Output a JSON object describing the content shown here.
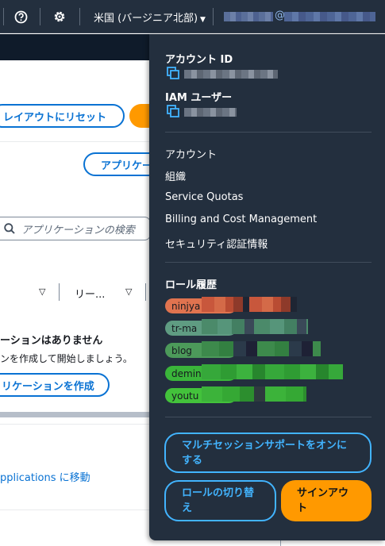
{
  "nav": {
    "help_icon": "question-circle-icon",
    "settings_icon": "gear-icon",
    "region": "米国 (バージニア北部)",
    "account_at": "@"
  },
  "background": {
    "reset_layout_button": "レイアウトにリセット",
    "application_button": "アプリケー",
    "search_placeholder": "アプリケーションの検索",
    "col_header": "リー...",
    "empty_title": "ーションはありません",
    "empty_desc": "ンを作成して開始しましょう。",
    "create_button": "リケーションを作成",
    "move_link": "pplications に移動"
  },
  "dropdown": {
    "account_id_label": "アカウント ID",
    "iam_user_label": "IAM ユーザー",
    "menu": [
      "アカウント",
      "組織",
      "Service Quotas",
      "Billing and Cost Management",
      "セキュリティ認証情報"
    ],
    "role_history_title": "ロール履歴",
    "roles": [
      {
        "name": "ninjya",
        "color": "#e0734f"
      },
      {
        "name": "tr-ma",
        "color": "#5f9c82"
      },
      {
        "name": "blog",
        "color": "#4c9a5a"
      },
      {
        "name": "demin",
        "color": "#3ab53a"
      },
      {
        "name": "youtu",
        "color": "#43c23b"
      }
    ],
    "multisession_button": "マルチセッションサポートをオンにする",
    "switch_role_button": "ロールの切り替え",
    "sign_out_button": "サインアウト"
  },
  "colors": {
    "nav_bg": "#232f3e",
    "link_blue": "#0972d3",
    "accent_orange": "#ff9900",
    "dropdown_button_blue": "#42b4ff"
  }
}
